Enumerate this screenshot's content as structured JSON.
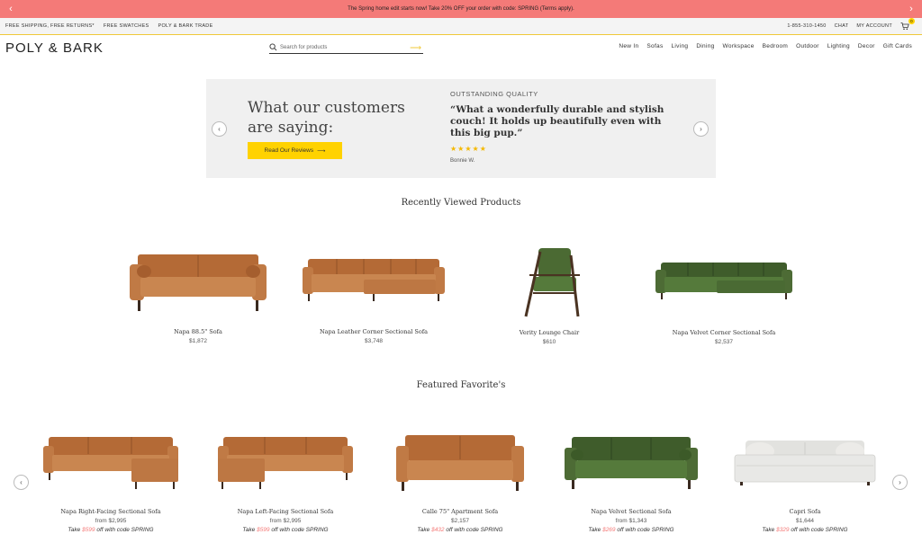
{
  "promo": {
    "text": "The Spring home edit starts now! Take 20% OFF your order with code: SPRING (Terms apply).",
    "prev": "‹",
    "next": "›"
  },
  "utility": {
    "left_links": [
      "FREE SHIPPING, FREE RETURNS*",
      "FREE SWATCHES",
      "POLY & BARK TRADE"
    ],
    "phone": "1-855-310-1450",
    "chat": "CHAT",
    "account": "MY ACCOUNT",
    "cart_count": "0"
  },
  "header": {
    "logo": "POLY & BARK",
    "search_placeholder": "Search for products",
    "search_arrow": "⟶",
    "nav": [
      "New In",
      "Sofas",
      "Living",
      "Dining",
      "Workspace",
      "Bedroom",
      "Outdoor",
      "Lighting",
      "Decor",
      "Gift Cards"
    ]
  },
  "reviews": {
    "title": "What our customers are saying:",
    "button": "Read Our Reviews",
    "button_arrow": "⟶",
    "eyebrow": "OUTSTANDING QUALITY",
    "quote": "“What a wonderfully durable and stylish couch! It holds up beautifully even with this big pup.”",
    "stars": "★★★★★",
    "author": "Bonnie W.",
    "prev": "‹",
    "next": "›"
  },
  "recently_viewed": {
    "title": "Recently Viewed Products",
    "items": [
      {
        "name": "Napa 88.5\" Sofa",
        "price": "$1,872"
      },
      {
        "name": "Napa Leather Corner Sectional Sofa",
        "price": "$3,748"
      },
      {
        "name": "Verity Lounge Chair",
        "price": "$610"
      },
      {
        "name": "Napa Velvet Corner Sectional Sofa",
        "price": "$2,537"
      }
    ]
  },
  "featured": {
    "title": "Featured Favorite's",
    "prev": "‹",
    "next": "›",
    "items": [
      {
        "name": "Napa Right-Facing Sectional Sofa",
        "price": "from $2,995",
        "promo_pre": "Take ",
        "promo_amt": "$599",
        "promo_post": " off with code SPRING"
      },
      {
        "name": "Napa Left-Facing Sectional Sofa",
        "price": "from $2,995",
        "promo_pre": "Take ",
        "promo_amt": "$599",
        "promo_post": " off with code SPRING"
      },
      {
        "name": "Calle 75\" Apartment Sofa",
        "price": "$2,157",
        "promo_pre": "Take ",
        "promo_amt": "$432",
        "promo_post": " off with code SPRING"
      },
      {
        "name": "Napa Velvet Sectional Sofa",
        "price": "from $1,343",
        "promo_pre": "Take ",
        "promo_amt": "$269",
        "promo_post": " off with code SPRING"
      },
      {
        "name": "Capri Sofa",
        "price": "$1,644",
        "promo_pre": "Take ",
        "promo_amt": "$329",
        "promo_post": " off with code SPRING"
      }
    ]
  },
  "colors": {
    "promo_bg": "#f47a78",
    "accent_yellow": "#ffd200",
    "leather": "#c07a45",
    "velvet_green": "#4d6b35",
    "white_linen": "#e8e8e6"
  }
}
